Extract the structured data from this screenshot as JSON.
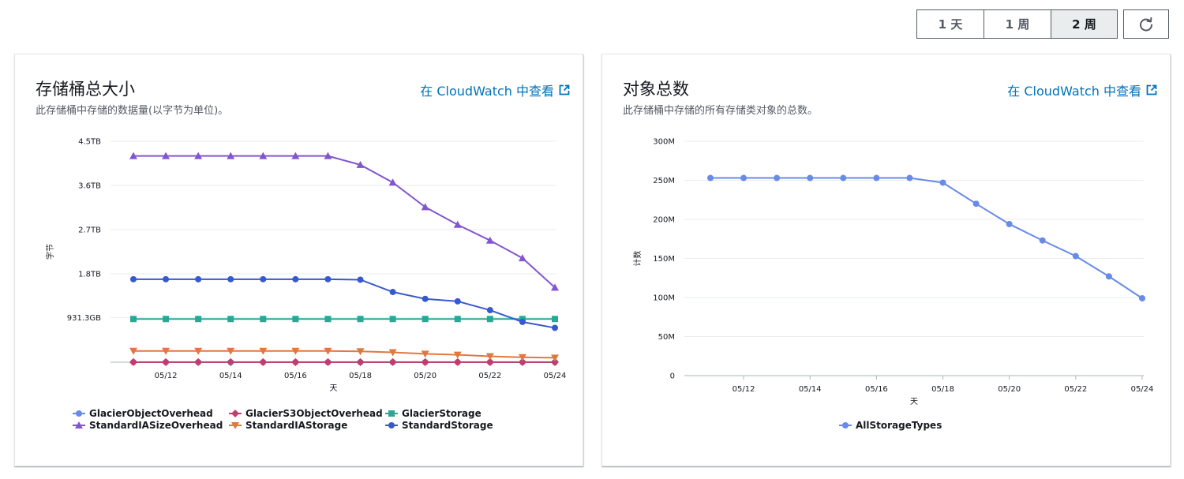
{
  "toolbar": {
    "ranges": [
      "1 天",
      "1 周",
      "2 周"
    ],
    "active_range": "2 周"
  },
  "panels": {
    "size": {
      "title": "存储桶总大小",
      "description": "此存储桶中存储的数据量(以字节为单位)。",
      "link": "在 CloudWatch 中查看"
    },
    "count": {
      "title": "对象总数",
      "description": "此存储桶中存储的所有存储类对象的总数。",
      "link": "在 CloudWatch 中查看"
    }
  },
  "chart_data": [
    {
      "type": "line",
      "xlabel": "天",
      "ylabel": "字节",
      "x": [
        "05/11",
        "05/12",
        "05/13",
        "05/14",
        "05/15",
        "05/16",
        "05/17",
        "05/18",
        "05/19",
        "05/20",
        "05/21",
        "05/22",
        "05/23",
        "05/24"
      ],
      "x_ticks": [
        "05/12",
        "05/14",
        "05/16",
        "05/18",
        "05/20",
        "05/22",
        "05/24"
      ],
      "y_unit": "TB",
      "y_ticks": [
        {
          "value": 0.9095,
          "label": "931.3GB"
        },
        {
          "value": 1.8,
          "label": "1.8TB"
        },
        {
          "value": 2.7,
          "label": "2.7TB"
        },
        {
          "value": 3.6,
          "label": "3.6TB"
        },
        {
          "value": 4.5,
          "label": "4.5TB"
        }
      ],
      "ylim": [
        0,
        4.5
      ],
      "grid": true,
      "legend_position": "bottom",
      "series": [
        {
          "name": "GlacierObjectOverhead",
          "color": "#688ae8",
          "marker": "circle",
          "values": [
            0.001,
            0.001,
            0.001,
            0.001,
            0.001,
            0.001,
            0.001,
            0.001,
            0.001,
            0.001,
            0.001,
            0.001,
            0.001,
            0.001
          ]
        },
        {
          "name": "GlacierS3ObjectOverhead",
          "color": "#c33d69",
          "marker": "diamond",
          "values": [
            0.002,
            0.002,
            0.002,
            0.002,
            0.002,
            0.002,
            0.002,
            0.002,
            0.002,
            0.002,
            0.002,
            0.002,
            0.002,
            0.002
          ]
        },
        {
          "name": "GlacierStorage",
          "color": "#2ea597",
          "marker": "square",
          "values": [
            0.88,
            0.88,
            0.88,
            0.88,
            0.88,
            0.88,
            0.88,
            0.88,
            0.88,
            0.88,
            0.88,
            0.88,
            0.88,
            0.88
          ]
        },
        {
          "name": "StandardIASizeOverhead",
          "color": "#8456ce",
          "marker": "triangle",
          "values": [
            4.2,
            4.2,
            4.2,
            4.2,
            4.2,
            4.2,
            4.2,
            4.02,
            3.66,
            3.16,
            2.8,
            2.48,
            2.12,
            1.52
          ]
        },
        {
          "name": "StandardIAStorage",
          "color": "#e07941",
          "marker": "triangle-down",
          "values": [
            0.23,
            0.23,
            0.23,
            0.23,
            0.23,
            0.23,
            0.23,
            0.22,
            0.2,
            0.17,
            0.15,
            0.12,
            0.1,
            0.09
          ]
        },
        {
          "name": "StandardStorage",
          "color": "#3759ce",
          "marker": "circle",
          "values": [
            1.69,
            1.69,
            1.69,
            1.69,
            1.69,
            1.69,
            1.69,
            1.68,
            1.43,
            1.29,
            1.24,
            1.06,
            0.82,
            0.7
          ]
        }
      ]
    },
    {
      "type": "line",
      "xlabel": "天",
      "ylabel": "计数",
      "x": [
        "05/11",
        "05/12",
        "05/13",
        "05/14",
        "05/15",
        "05/16",
        "05/17",
        "05/18",
        "05/19",
        "05/20",
        "05/21",
        "05/22",
        "05/23",
        "05/24"
      ],
      "x_ticks": [
        "05/12",
        "05/14",
        "05/16",
        "05/18",
        "05/20",
        "05/22",
        "05/24"
      ],
      "y_ticks": [
        {
          "value": 0,
          "label": "0"
        },
        {
          "value": 50,
          "label": "50M"
        },
        {
          "value": 100,
          "label": "100M"
        },
        {
          "value": 150,
          "label": "150M"
        },
        {
          "value": 200,
          "label": "200M"
        },
        {
          "value": 250,
          "label": "250M"
        },
        {
          "value": 300,
          "label": "300M"
        }
      ],
      "y_unit": "M",
      "ylim": [
        0,
        300
      ],
      "grid": true,
      "legend_position": "bottom",
      "series": [
        {
          "name": "AllStorageTypes",
          "color": "#688ae8",
          "marker": "circle",
          "values": [
            253,
            253,
            253,
            253,
            253,
            253,
            253,
            247,
            220,
            194,
            173,
            153,
            127,
            99
          ]
        }
      ]
    }
  ]
}
